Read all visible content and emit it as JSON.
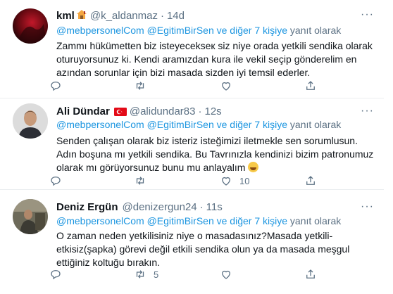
{
  "tweets": [
    {
      "name": "kml",
      "handle": "@k_aldanmaz",
      "sep": "·",
      "time": "14d",
      "more": "···",
      "reply_mentions": "@mebpersonelCom @EgitimBirSen",
      "reply_others": " ve diğer 7 kişiye",
      "reply_suffix": " yanıt olarak",
      "text": "Zammı hükümetten biz isteyecekseк siz niye orada yetkili sendika olarak oturuyorsunuz ki. Kendi aramızdan kura ile vekil seçip gönderelim en azından sorunlar için bizi masada sizden iyi temsil ederler.",
      "retweets": "",
      "likes": ""
    },
    {
      "name": "Ali Dündar",
      "handle": "@alidundar83",
      "sep": "·",
      "time": "12s",
      "more": "···",
      "reply_mentions": "@mebpersonelCom @EgitimBirSen",
      "reply_others": " ve diğer 7 kişiye",
      "reply_suffix": " yanıt olarak",
      "text": "Senden çalışan olarak biz isteriz isteğimizi iletmekle sen sorumlusun. Adın boşuna mı yetkili sendika. Bu Tavrınızla kendinizi bizim patronumuz olarak mı görüyorsunuz bunu mu anlayalım",
      "retweets": "",
      "likes": "10"
    },
    {
      "name": "Deniz Ergün",
      "handle": "@denizergun24",
      "sep": "·",
      "time": "11s",
      "more": "···",
      "reply_mentions": "@mebpersonelCom @EgitimBirSen",
      "reply_others": " ve diğer 7 kişiye",
      "reply_suffix": " yanıt olarak",
      "text": "O zaman neden yetkilisiniz niye o masadasınız?Masada yetkili-etkisiz(şapka) görevi değil etkili sendika olun ya da  masada meşgul ettiğiniz koltuğu bırakın.",
      "retweets": "5",
      "likes": ""
    }
  ],
  "colors": {
    "link": "#1b95e0",
    "muted": "#5b7083",
    "text": "#0f1419",
    "border": "#ebeef0"
  },
  "icons": [
    "reply-icon",
    "retweet-icon",
    "like-icon",
    "share-icon",
    "house-emoji-icon",
    "turkey-flag-icon",
    "grinning-emoji-icon",
    "more-icon"
  ]
}
